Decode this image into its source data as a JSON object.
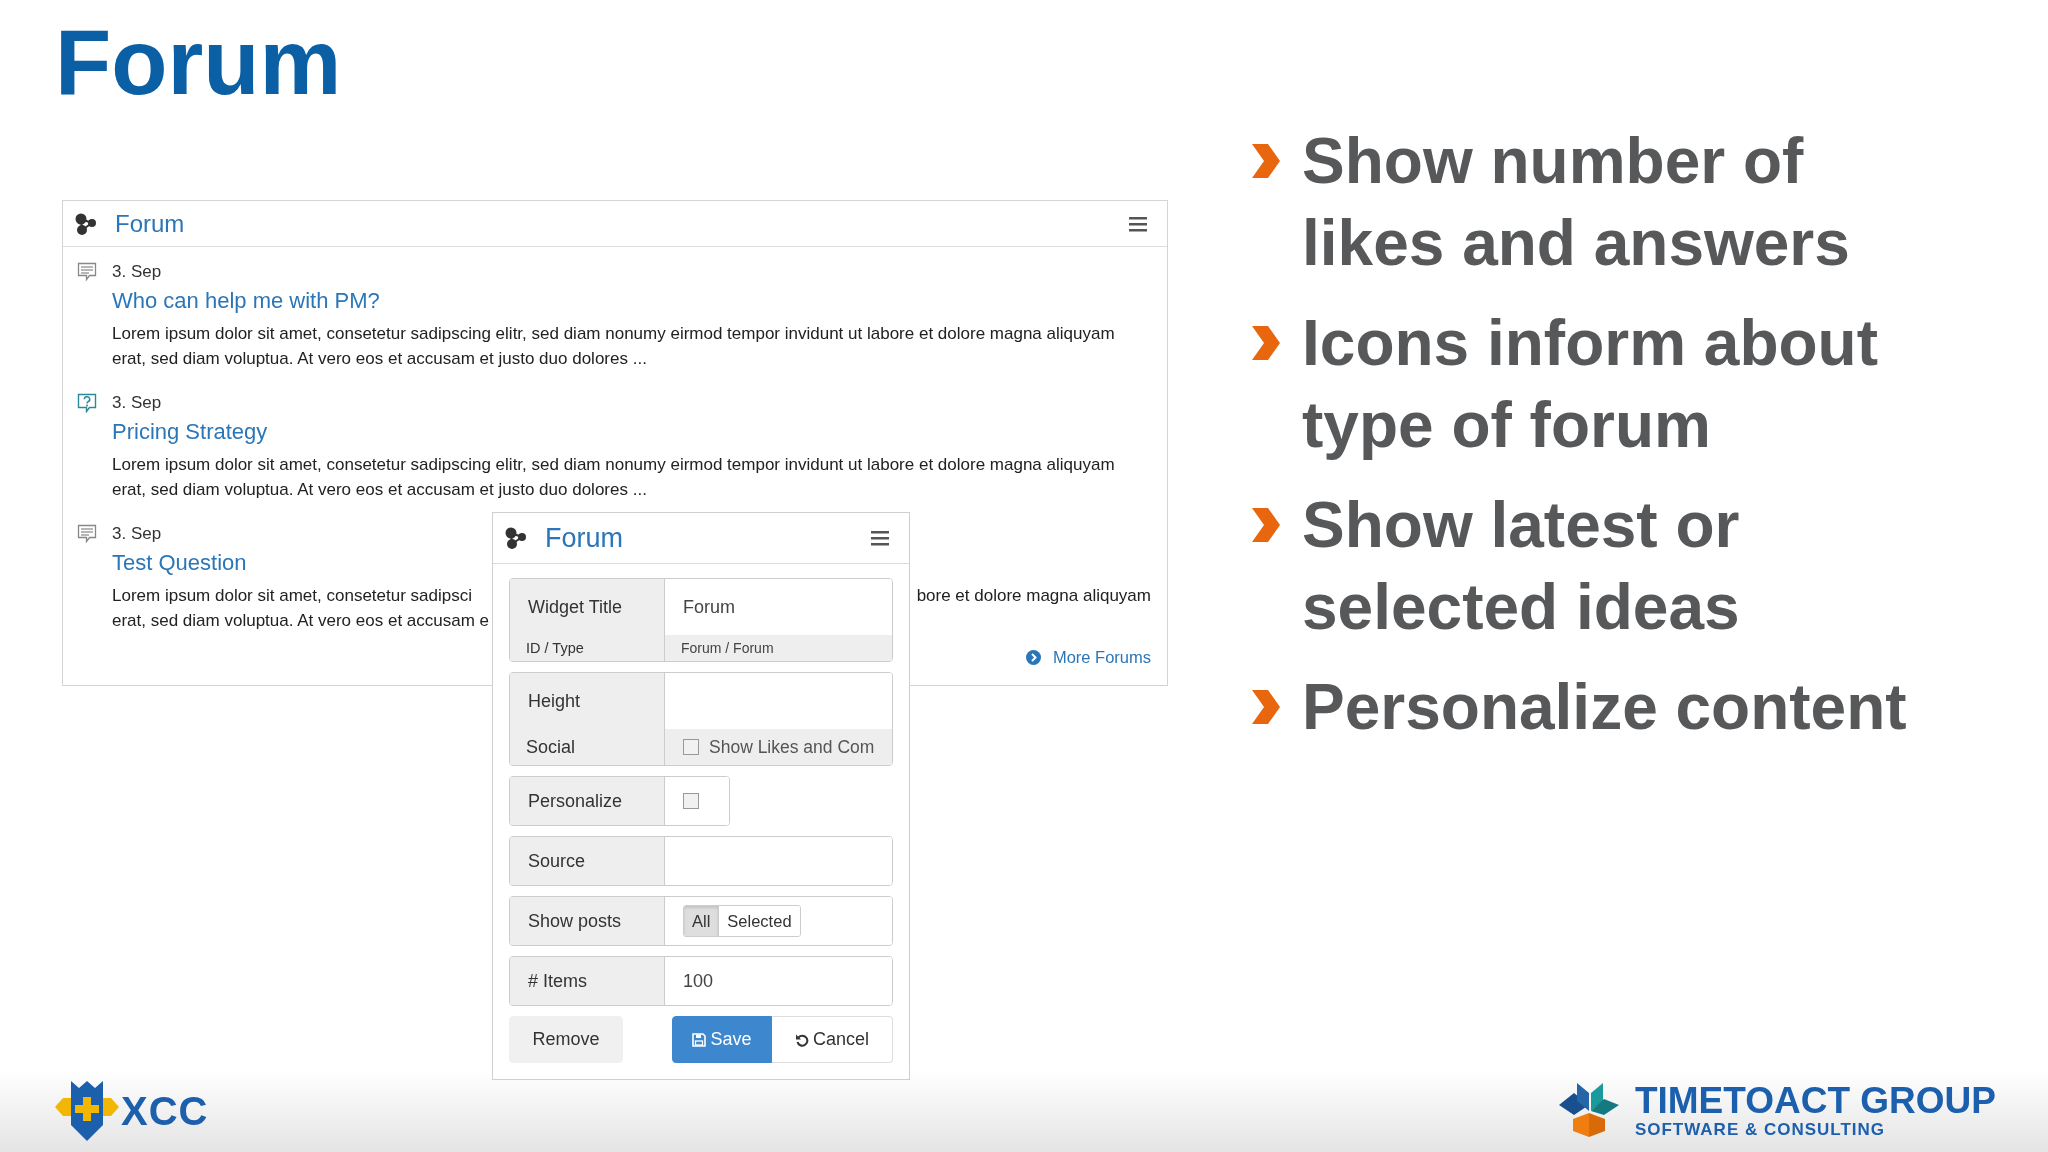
{
  "slide_title": "Forum",
  "widget": {
    "title": "Forum",
    "posts": [
      {
        "kind": "discussion",
        "date": "3. Sep",
        "title": "Who can help me with PM?",
        "body_lines": [
          {
            "left": "Lorem ipsum dolor sit amet, consetetur sadipscing elitr, sed diam nonumy eirmod tempor invidunt ut labore et dolore magna aliquyam"
          },
          {
            "left": "erat, sed diam voluptua. At vero eos et accusam et justo duo dolores ..."
          }
        ]
      },
      {
        "kind": "question",
        "date": "3. Sep",
        "title": "Pricing Strategy",
        "body_lines": [
          {
            "left": "Lorem ipsum dolor sit amet, consetetur sadipscing elitr, sed diam nonumy eirmod tempor invidunt ut labore et dolore magna aliquyam"
          },
          {
            "left": "erat, sed diam voluptua. At vero eos et accusam et justo duo dolores ..."
          }
        ]
      },
      {
        "kind": "discussion",
        "date": "3. Sep",
        "title": "Test Question",
        "body_lines": [
          {
            "left": "Lorem ipsum dolor sit amet, consetetur sadipsci",
            "right": "bore et dolore magna aliquyam"
          },
          {
            "left": "erat, sed diam voluptua. At vero eos et accusam e"
          }
        ]
      }
    ],
    "more_link": "More Forums"
  },
  "settings": {
    "title": "Forum",
    "groups": [
      {
        "rows": [
          {
            "kind": "text",
            "label": "Widget Title",
            "value": "Forum"
          },
          {
            "kind": "info",
            "label": "ID / Type",
            "value": "Forum / Forum"
          }
        ]
      },
      {
        "rows": [
          {
            "kind": "text",
            "label": "Height"
          },
          {
            "kind": "checkbox",
            "label": "Social",
            "checked": false,
            "text": "Show Likes and Com"
          }
        ]
      },
      {
        "rows": [
          {
            "kind": "checkbox",
            "label": "Personalize",
            "checked": false
          }
        ]
      },
      {
        "rows": [
          {
            "kind": "text",
            "label": "Source"
          }
        ]
      },
      {
        "rows": [
          {
            "kind": "segmented",
            "label": "Show posts",
            "options": [
              {
                "label": "All",
                "selected": true
              },
              {
                "label": "Selected",
                "selected": false
              }
            ]
          }
        ]
      },
      {
        "rows": [
          {
            "kind": "text",
            "label": "# Items",
            "value": "100"
          }
        ]
      }
    ],
    "buttons": [
      {
        "kind": "remove",
        "label": "Remove"
      },
      {
        "kind": "save",
        "label": "Save"
      },
      {
        "kind": "cancel",
        "label": "Cancel"
      }
    ]
  },
  "bullets": [
    "Show number of likes and answers",
    "Icons inform about type of forum",
    "Show latest or selected ideas",
    "Personalize content"
  ],
  "footer": {
    "left_logo": {
      "text": "XCC"
    },
    "right_logo": {
      "name": "TIMETOACT GROUP",
      "tagline": "SOFTWARE & CONSULTING"
    }
  }
}
